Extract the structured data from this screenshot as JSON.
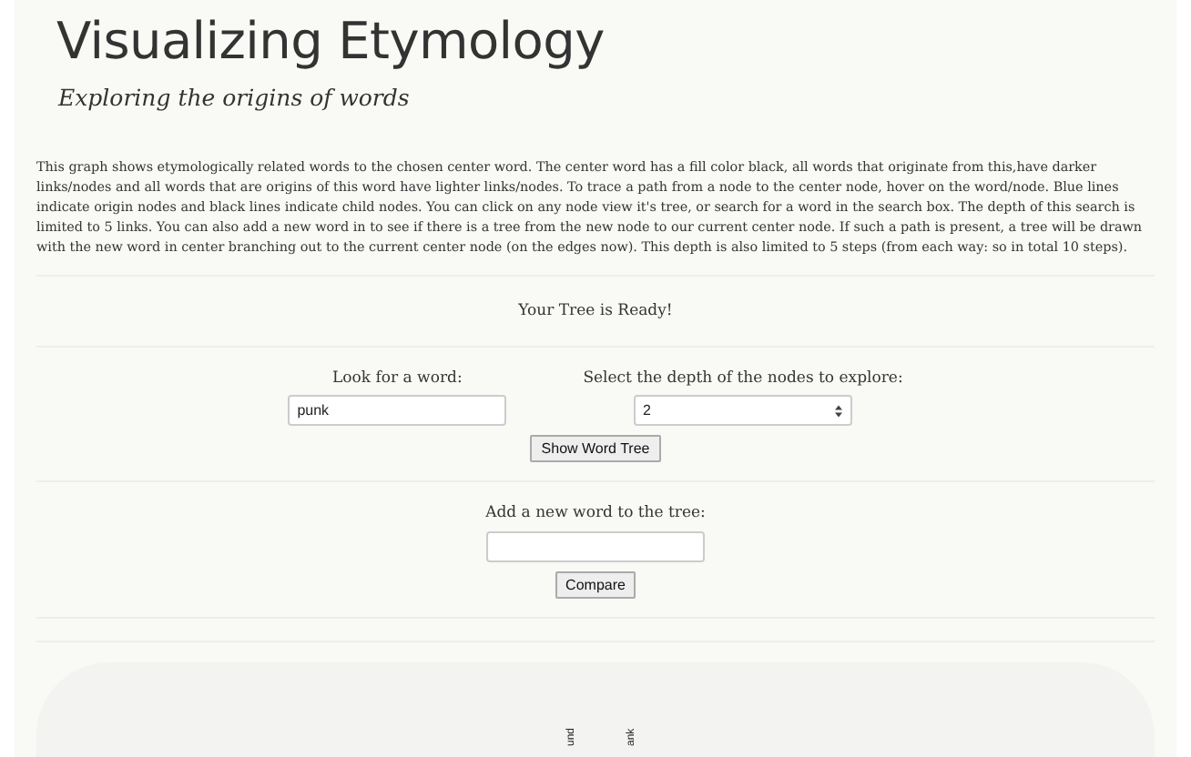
{
  "title": "Visualizing Etymology",
  "subtitle": "Exploring the origins of words",
  "description": "This graph shows etymologically related words to the chosen center word. The center word has a fill color black, all words that originate from this,have darker links/nodes and all words that are origins of this word have lighter links/nodes. To trace a path from a node to the center node, hover on the word/node. Blue lines indicate origin nodes and black lines indicate child nodes. You can click on any node view it's tree, or search for a word in the search box. The depth of this search is limited to 5 links. You can also add a new word in to see if there is a tree from the new node to our current center node. If such a path is present, a tree will be drawn with the new word in center branching out to the current center node (on the edges now). This depth is also limited to 5 steps (from each way: so in total 10 steps).",
  "status": "Your Tree is Ready!",
  "search": {
    "label": "Look for a word:",
    "value": "punk"
  },
  "depth": {
    "label": "Select the depth of the nodes to explore:",
    "value": "2"
  },
  "show_button": "Show Word Tree",
  "compare": {
    "label": "Add a new word to the tree:",
    "button": "Compare"
  },
  "tree_nodes": [
    {
      "label": "und"
    },
    {
      "label": "ank"
    }
  ]
}
